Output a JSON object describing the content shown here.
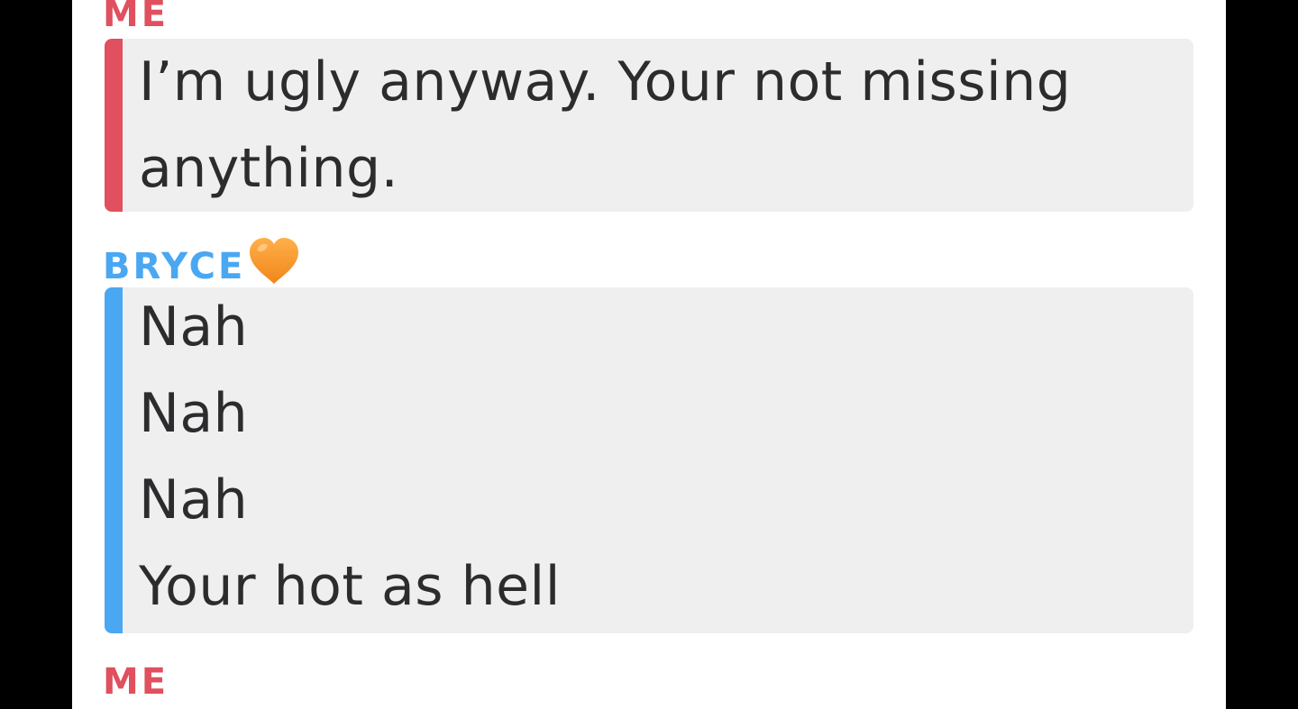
{
  "chat": {
    "messages": [
      {
        "sender": "ME",
        "lines": [
          "I’m ugly anyway. Your not missing",
          "anything."
        ]
      },
      {
        "sender": "BRYCE",
        "sender_emoji": "orange-heart",
        "lines": [
          "Nah",
          "Nah",
          "Nah",
          "Your hot as hell"
        ]
      },
      {
        "sender": "ME",
        "lines": []
      }
    ]
  },
  "colors": {
    "me": "#e0505e",
    "bryce": "#4aa7f2",
    "bubble_bg": "#efefef",
    "text": "#2c2c2e",
    "heart": "#f5921e"
  }
}
